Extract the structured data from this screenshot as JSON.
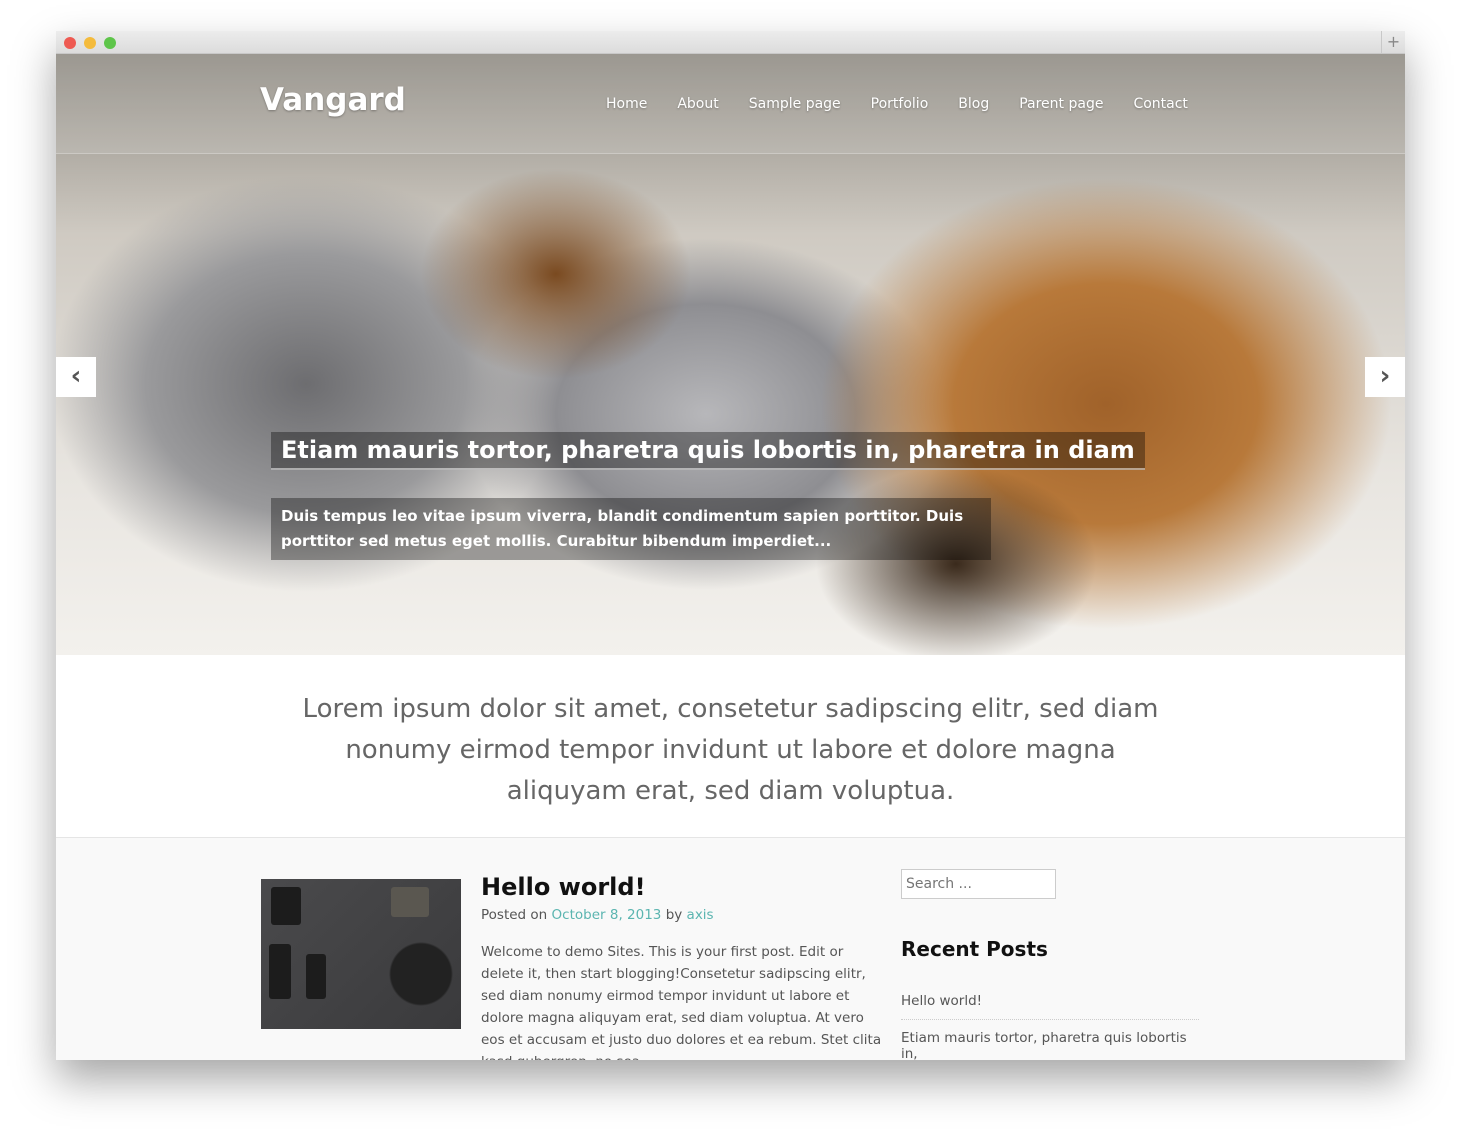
{
  "window": {
    "controls": [
      "#ee5a52",
      "#f4bb3c",
      "#5ec54a"
    ],
    "new_tab_icon": "plus-icon"
  },
  "header": {
    "logo": "Vangard",
    "nav": [
      "Home",
      "About",
      "Sample page",
      "Portfolio",
      "Blog",
      "Parent page",
      "Contact"
    ]
  },
  "slider": {
    "prev_icon": "chevron-left-icon",
    "next_icon": "chevron-right-icon",
    "caption_title": "Etiam mauris tortor, pharetra quis lobortis in, pharetra in diam",
    "caption_text": "Duis tempus leo vitae ipsum viverra, blandit condimentum sapien porttitor. Duis porttitor sed metus eget mollis. Curabitur bibendum imperdiet..."
  },
  "intro": "Lorem ipsum dolor sit amet, consetetur sadipscing elitr, sed diam nonumy eirmod tempor invidunt ut labore et dolore magna aliquyam erat, sed diam voluptua.",
  "post": {
    "title": "Hello world!",
    "posted_on": "Posted on",
    "date": "October 8, 2013",
    "by": "by",
    "author": "axis",
    "excerpt": "Welcome to demo Sites. This is your first post. Edit or delete it, then start blogging!Consetetur sadipscing elitr, sed diam nonumy eirmod tempor invidunt ut labore et dolore magna aliquyam erat, sed diam voluptua. At vero eos et accusam et justo duo dolores et ea rebum. Stet clita kasd gubergren, no sea",
    "link_color": "#5bb5b0"
  },
  "sidebar": {
    "search_placeholder": "Search ...",
    "recent_title": "Recent Posts",
    "recent": [
      "Hello world!",
      "Etiam mauris tortor, pharetra quis lobortis in,"
    ]
  }
}
